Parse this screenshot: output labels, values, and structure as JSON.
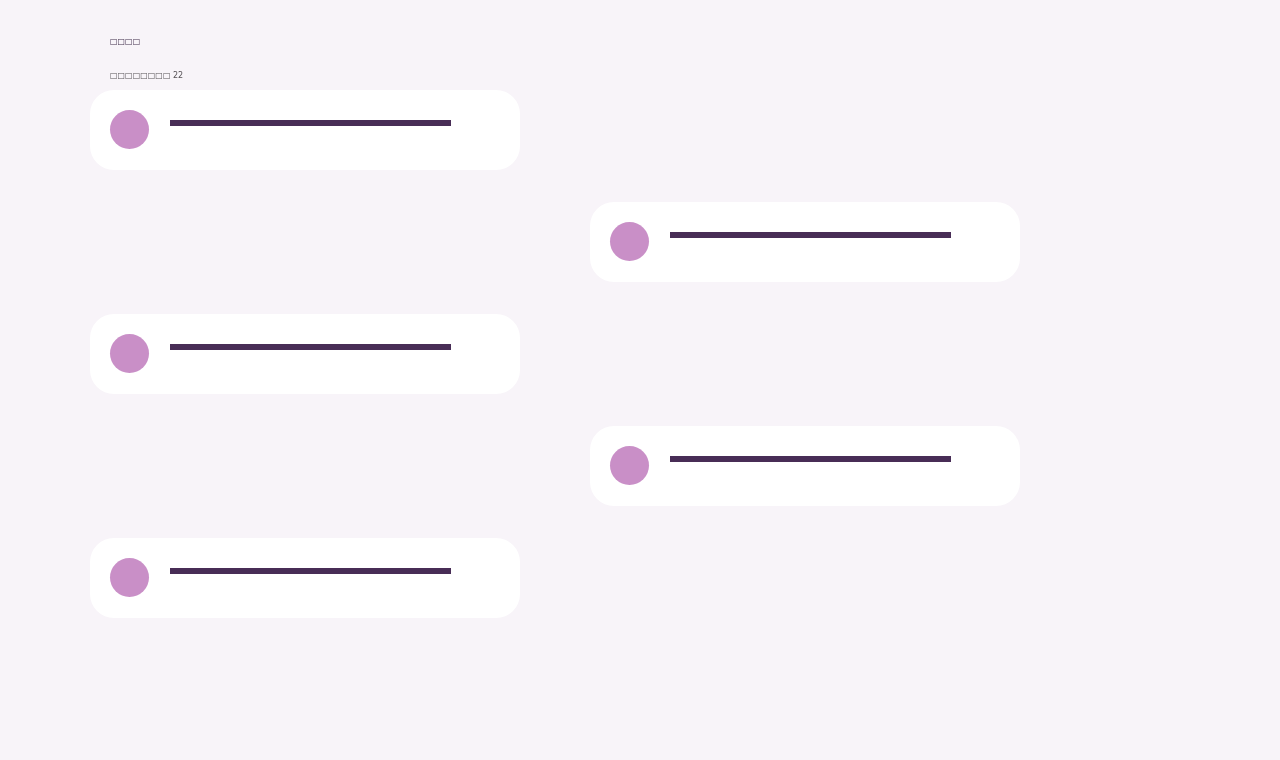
{
  "header": {
    "title": "□□□□",
    "subtitle": "□□□□□□□□ 22"
  },
  "messages": [
    {
      "kind": "left"
    },
    {
      "kind": "right"
    },
    {
      "kind": "left"
    },
    {
      "kind": "right"
    },
    {
      "kind": "left"
    }
  ]
}
